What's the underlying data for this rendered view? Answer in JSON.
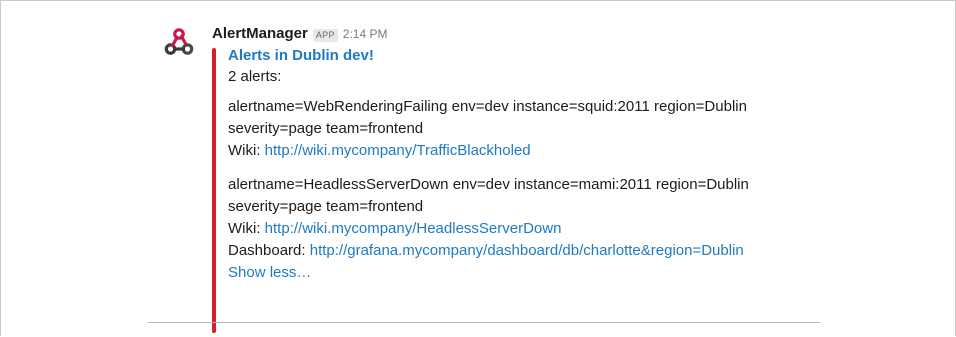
{
  "message": {
    "sender": "AlertManager",
    "badge": "APP",
    "time": "2:14 PM",
    "avatar_icon": "webhook-icon",
    "attachment": {
      "color": "#d2202e",
      "title": "Alerts in Dublin dev!",
      "summary": "2 alerts:",
      "alerts": [
        {
          "line1": "alertname=WebRenderingFailing env=dev instance=squid:2011 region=Dublin",
          "line2": "severity=page team=frontend",
          "wiki_label": "Wiki:",
          "wiki_url": "http://wiki.mycompany/TrafficBlackholed"
        },
        {
          "line1": "alertname=HeadlessServerDown env=dev instance=mami:2011 region=Dublin",
          "line2": "severity=page team=frontend",
          "wiki_label": "Wiki:",
          "wiki_url": "http://wiki.mycompany/HeadlessServerDown",
          "dashboard_label": "Dashboard:",
          "dashboard_url": "http://grafana.mycompany/dashboard/db/charlotte&region=Dublin"
        }
      ],
      "show_less": "Show less…"
    }
  },
  "colors": {
    "link": "#1e7ac4",
    "text": "#1d1c1d",
    "timestamp": "#7a7a7a"
  }
}
